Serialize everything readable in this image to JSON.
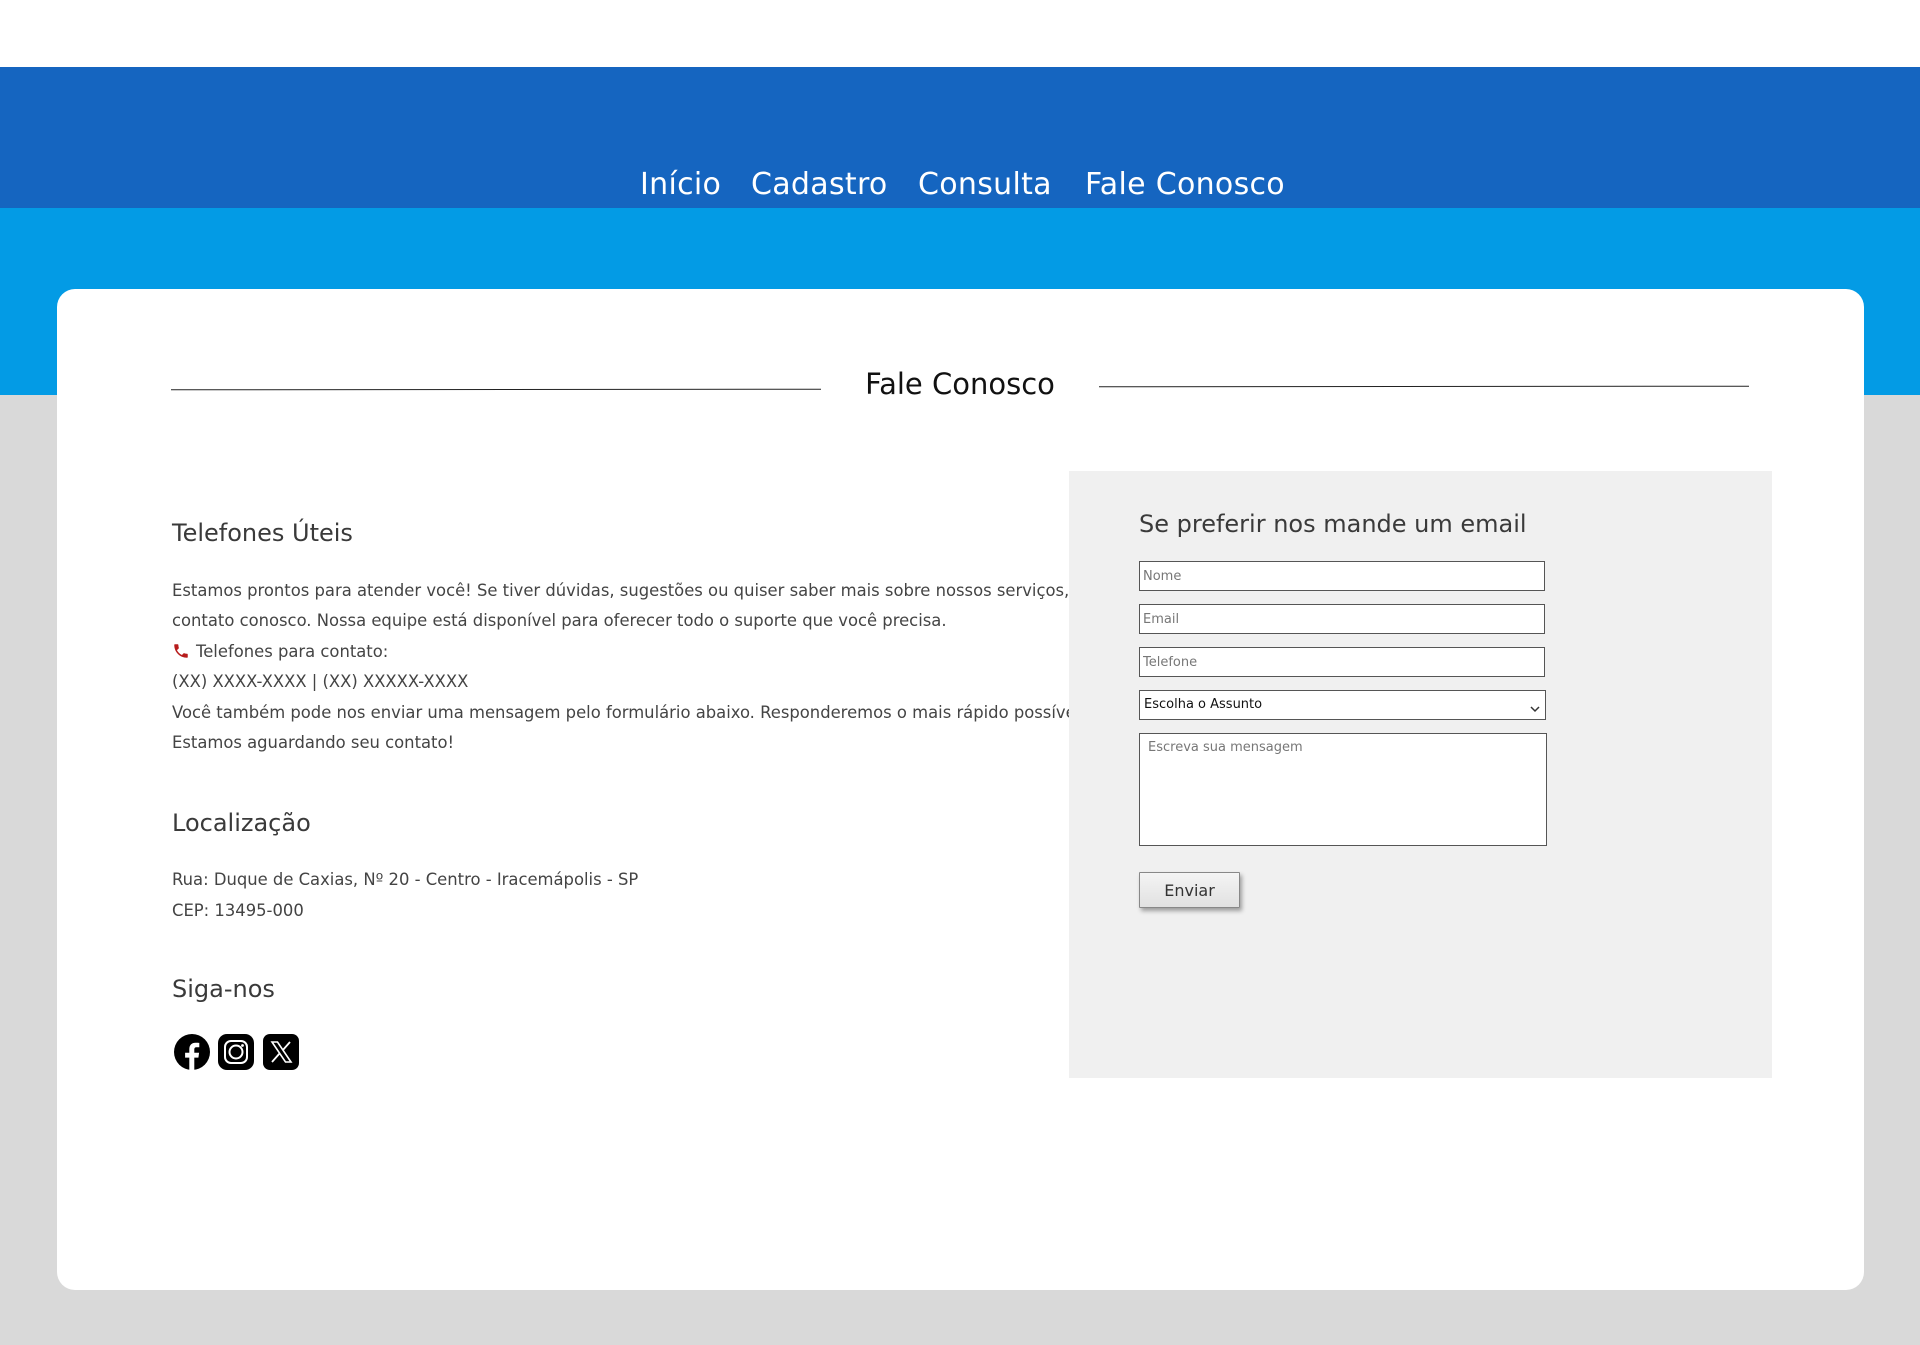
{
  "nav": {
    "items": [
      {
        "label": "Início"
      },
      {
        "label": "Cadastro"
      },
      {
        "label": "Consulta"
      },
      {
        "label": "Fale Conosco"
      }
    ]
  },
  "page": {
    "title": "Fale Conosco"
  },
  "phones": {
    "heading": "Telefones Úteis",
    "lines": [
      "Estamos prontos para atender você! Se tiver dúvidas, sugestões ou quiser saber mais sobre nossos serviços, entre em",
      "contato conosco. Nossa equipe está disponível para oferecer todo o suporte que você precisa.",
      "Telefones para contato:",
      "(XX) XXXX-XXXX | (XX) XXXXX-XXXX",
      "Você também pode nos enviar uma mensagem pelo formulário abaixo. Responderemos o mais rápido possível!",
      "Estamos aguardando seu contato!"
    ],
    "icon": "telephone-receiver-icon",
    "icon_color": "#b71c1c"
  },
  "location": {
    "heading": "Localização",
    "lines": [
      "Rua: Duque de Caxias, Nº 20 - Centro - Iracemápolis - SP",
      "CEP: 13495-000"
    ]
  },
  "social": {
    "heading": "Siga-nos",
    "icons": [
      "facebook-icon",
      "instagram-icon",
      "x-icon"
    ]
  },
  "form": {
    "title": "Se preferir nos mande um email",
    "name_placeholder": "Nome",
    "email_placeholder": "Email",
    "phone_placeholder": "Telefone",
    "subject_selected": "Escolha o Assunto",
    "message_placeholder": "Escreva sua mensagem",
    "submit_label": "Enviar"
  },
  "colors": {
    "nav_band": "#1565c0",
    "accent_band": "#039be5",
    "page_background": "#d9d9d9",
    "form_panel": "#f0f0f0"
  }
}
